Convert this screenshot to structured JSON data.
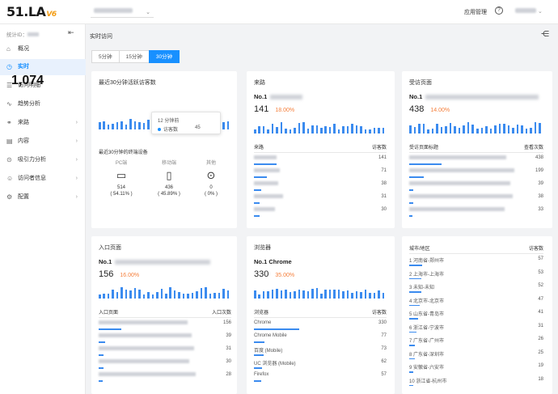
{
  "brand": {
    "logo": "51.LA",
    "version": "V6",
    "accent": "#1890ff"
  },
  "topbar": {
    "app_manage": "应用管理",
    "help_icon": "?"
  },
  "sidebar": {
    "stat_id_label": "统计ID：",
    "items": [
      {
        "label": "概况",
        "icon": "home-icon"
      },
      {
        "label": "实时",
        "icon": "clock-icon",
        "active": true
      },
      {
        "label": "访问明细",
        "icon": "list-icon"
      },
      {
        "label": "趋势分析",
        "icon": "trend-icon"
      },
      {
        "label": "来路",
        "icon": "link-icon"
      },
      {
        "label": "内容",
        "icon": "doc-icon"
      },
      {
        "label": "吸引力分析",
        "icon": "magnet-icon"
      },
      {
        "label": "访问者信息",
        "icon": "user-icon"
      },
      {
        "label": "配置",
        "icon": "gear-icon"
      }
    ]
  },
  "main": {
    "title": "实时访问",
    "tabs": [
      "5分钟",
      "15分钟",
      "30分钟"
    ],
    "active_tab": "30分钟"
  },
  "realtime": {
    "title": "最近30分钟活跃访客数",
    "value": "1,074",
    "tooltip_time": "12 分钟前",
    "tooltip_label": "访客数",
    "tooltip_value": "45",
    "devices_title": "最近30分钟的终端设备",
    "devices": [
      {
        "name": "PC端",
        "count": "514",
        "pct": "( 54.11% )",
        "icon": "monitor-icon"
      },
      {
        "name": "移动端",
        "count": "436",
        "pct": "( 45.89% )",
        "icon": "phone-icon"
      },
      {
        "name": "其他",
        "count": "0",
        "pct": "( 0% )",
        "icon": "other-icon"
      }
    ]
  },
  "referrer": {
    "title": "来路",
    "no1": "No.1",
    "value": "141",
    "pct": "18.00%",
    "col1": "来路",
    "col2": "访客数",
    "rows": [
      "141",
      "71",
      "38",
      "31",
      "30"
    ]
  },
  "visited": {
    "title": "受访页面",
    "no1": "No.1",
    "value": "438",
    "pct": "14.00%",
    "col1": "受访页面标题",
    "col2": "查看次数",
    "rows": [
      "438",
      "199",
      "39",
      "38",
      "33"
    ]
  },
  "entry": {
    "title": "入口页面",
    "no1": "No.1",
    "value": "156",
    "pct": "16.00%",
    "col1": "入口页面",
    "col2": "入口次数",
    "rows": [
      "156",
      "39",
      "31",
      "30",
      "28"
    ]
  },
  "browser": {
    "title": "浏览器",
    "no1": "No.1 Chrome",
    "value": "330",
    "pct": "35.00%",
    "col1": "浏览器",
    "col2": "访客数",
    "rows": [
      {
        "name": "Chrome",
        "value": "330"
      },
      {
        "name": "Chrome Mobile",
        "value": "77"
      },
      {
        "name": "百度 (Mobile)",
        "value": "73"
      },
      {
        "name": "UC 浏览器 (Mobile)",
        "value": "62"
      },
      {
        "name": "Firefox",
        "value": "57"
      }
    ]
  },
  "city": {
    "col1": "城市/地区",
    "col2": "访客数",
    "rows": [
      {
        "name": "1 河南省-郑州市",
        "value": "57"
      },
      {
        "name": "2 上海市-上海市",
        "value": "53"
      },
      {
        "name": "3 未知-未知",
        "value": "52"
      },
      {
        "name": "4 北京市-北京市",
        "value": "47"
      },
      {
        "name": "5 山东省-青岛市",
        "value": "41"
      },
      {
        "name": "6 浙江省-宁波市",
        "value": "31"
      },
      {
        "name": "7 广东省-广州市",
        "value": "26"
      },
      {
        "name": "8 广东省-深圳市",
        "value": "25"
      },
      {
        "name": "9 安徽省-六安市",
        "value": "19"
      },
      {
        "name": "10 浙江省-杭州市",
        "value": "18"
      }
    ]
  }
}
